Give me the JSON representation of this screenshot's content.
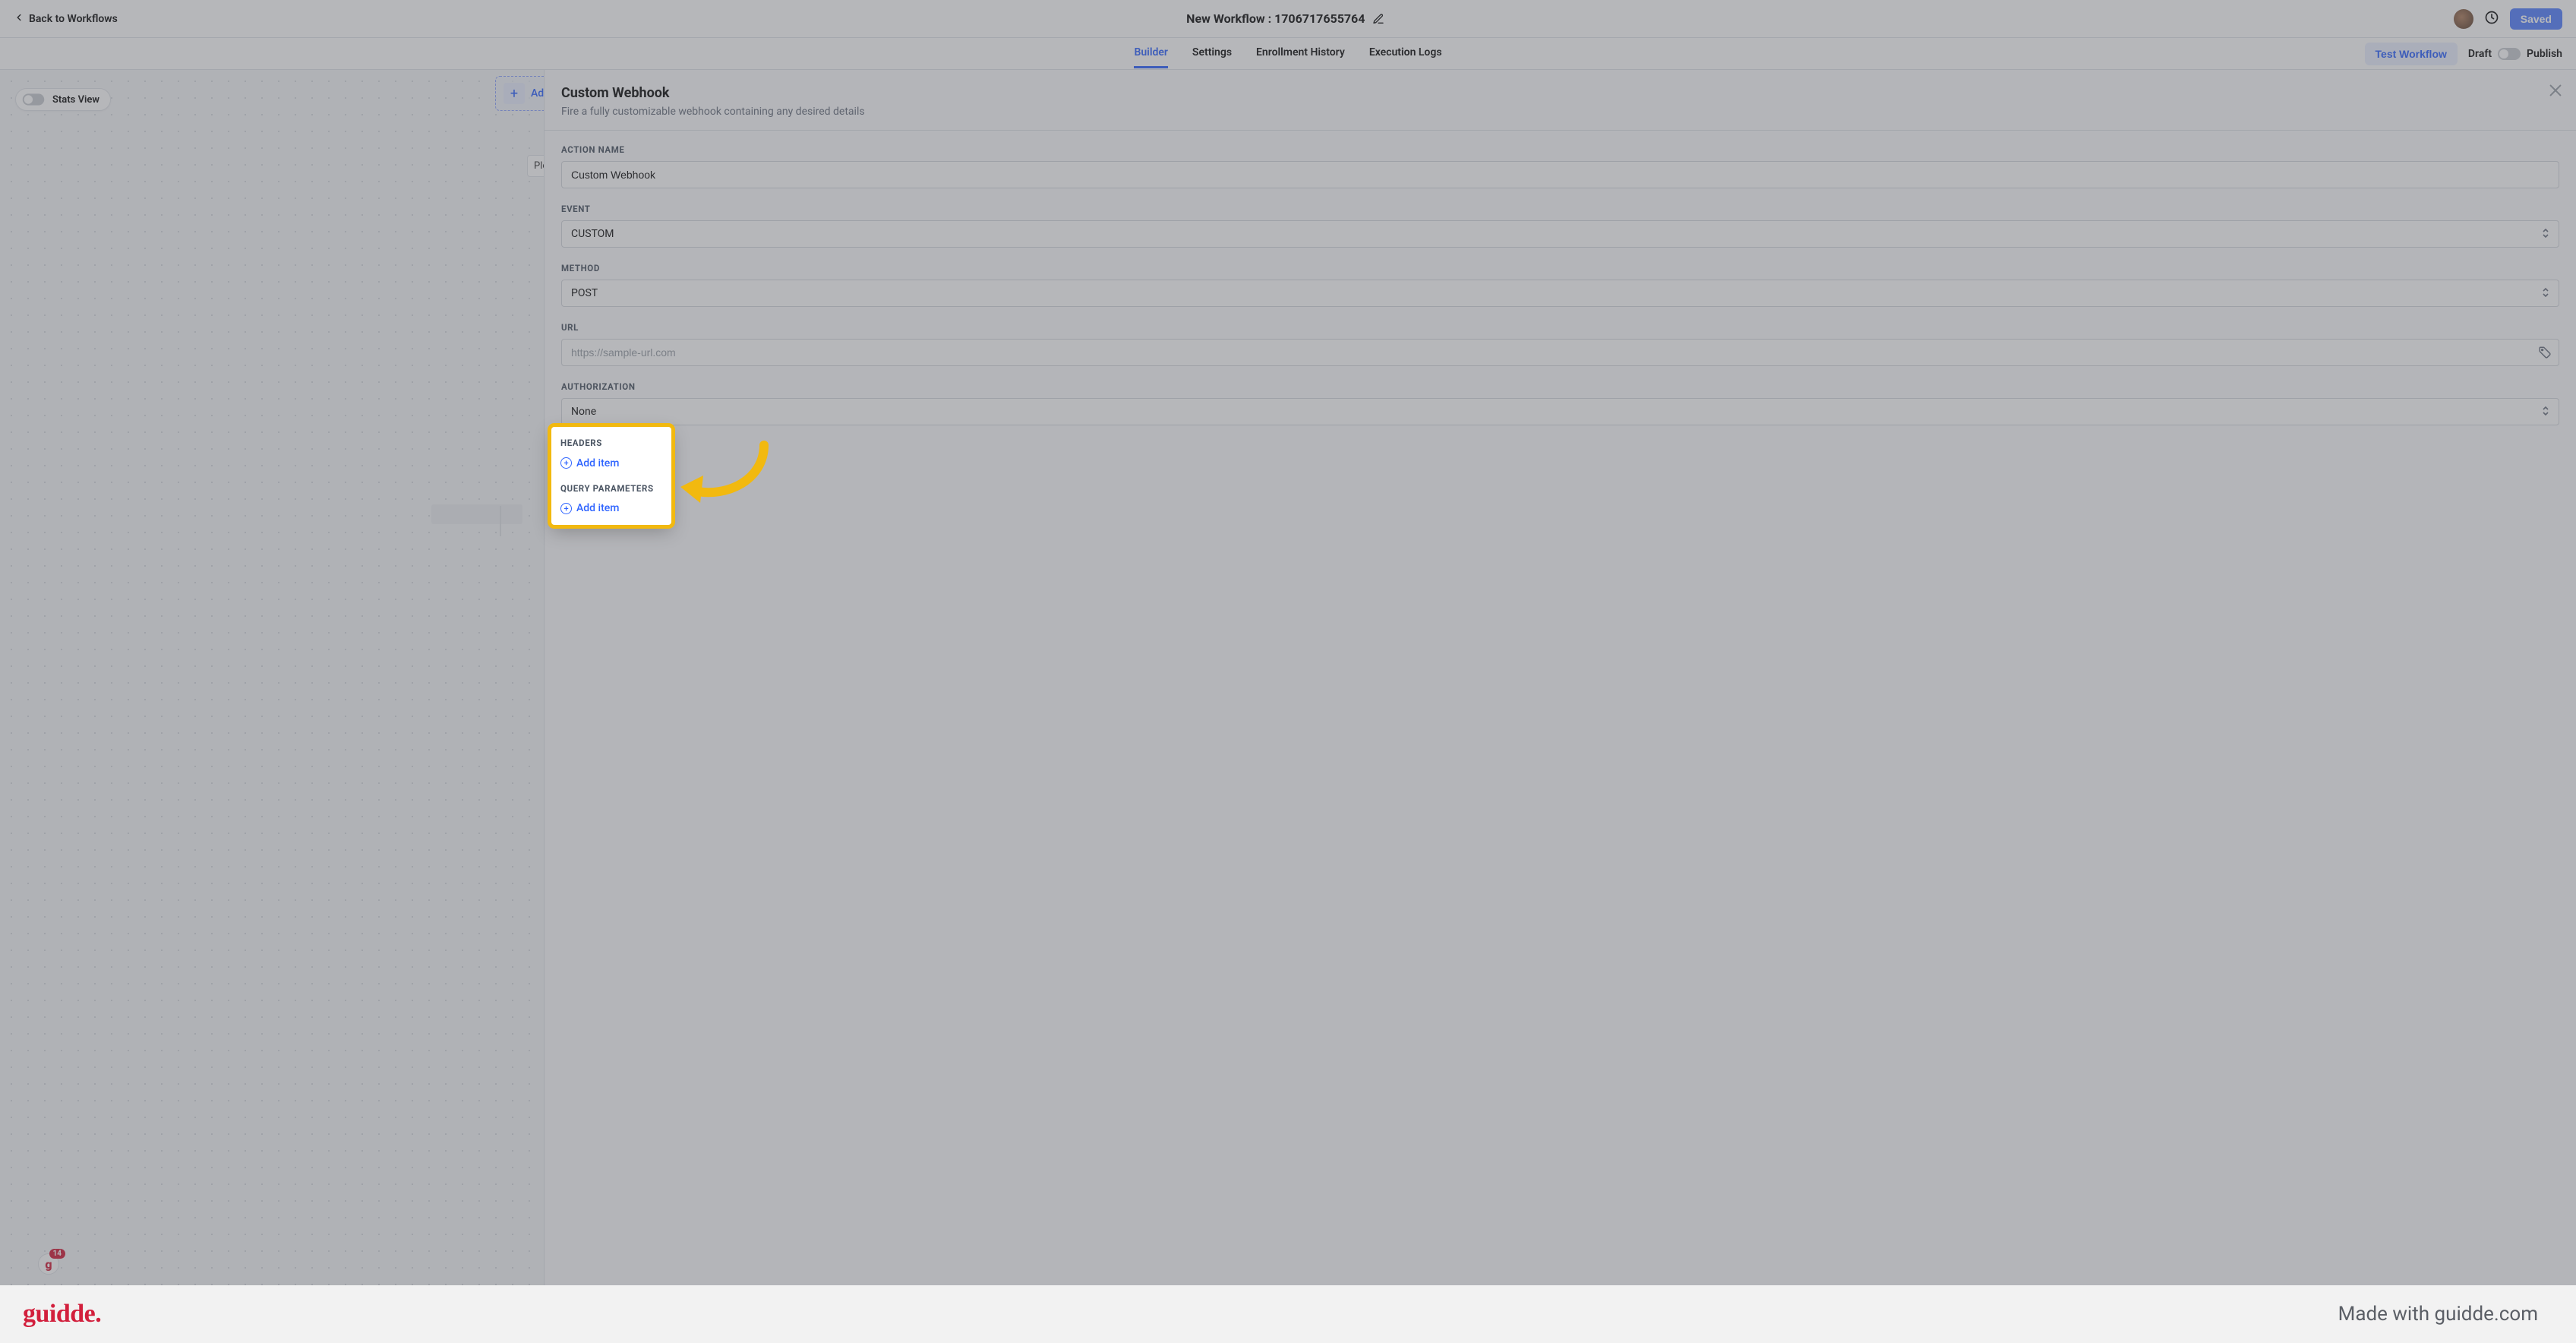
{
  "header": {
    "back_label": "Back to Workflows",
    "title": "New Workflow : 1706717655764",
    "saved_label": "Saved"
  },
  "tabs": {
    "items": [
      "Builder",
      "Settings",
      "Enrollment History",
      "Execution Logs"
    ],
    "active_index": 0,
    "test_label": "Test Workflow",
    "draft_label": "Draft",
    "publish_label": "Publish"
  },
  "canvas": {
    "stats_label": "Stats View",
    "add_trigger_label": "Ad",
    "ple_text": "Ple"
  },
  "panel": {
    "title": "Custom Webhook",
    "subtitle": "Fire a fully customizable webhook containing any desired details",
    "fields": {
      "action_name": {
        "label": "ACTION NAME",
        "value": "Custom Webhook"
      },
      "event": {
        "label": "EVENT",
        "value": "CUSTOM"
      },
      "method": {
        "label": "METHOD",
        "value": "POST"
      },
      "url": {
        "label": "URL",
        "placeholder": "https://sample-url.com"
      },
      "authorization": {
        "label": "AUTHORIZATION",
        "value": "None"
      },
      "headers": {
        "label": "HEADERS",
        "add_label": "Add item"
      },
      "query": {
        "label": "QUERY PARAMETERS",
        "add_label": "Add item"
      }
    }
  },
  "widget": {
    "badge": "14"
  },
  "footer": {
    "logo": "guidde.",
    "right": "Made with guidde.com"
  }
}
